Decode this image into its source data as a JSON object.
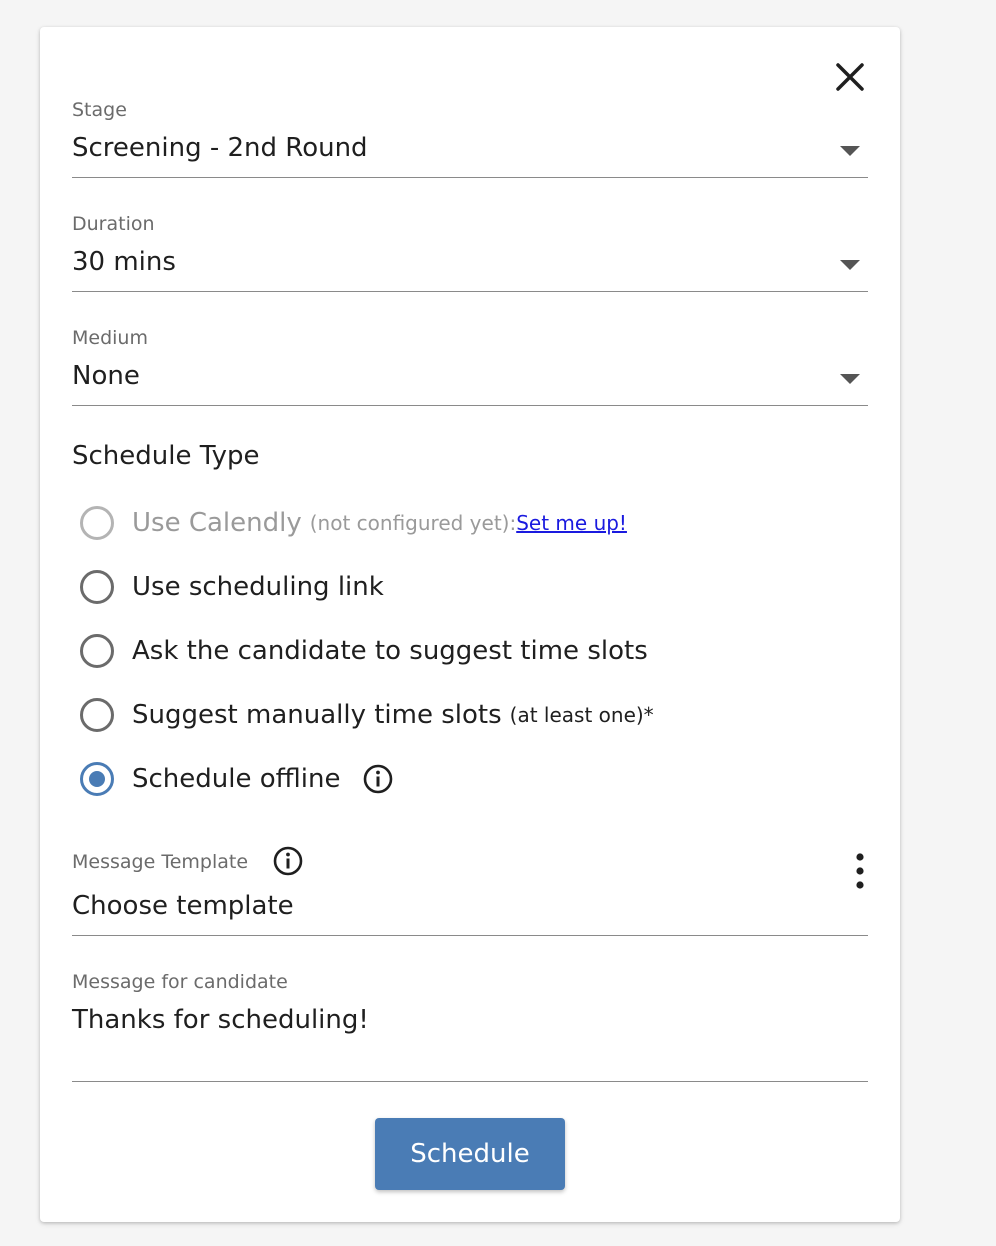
{
  "stage": {
    "label": "Stage",
    "value": "Screening - 2nd Round"
  },
  "duration": {
    "label": "Duration",
    "value": "30 mins"
  },
  "medium": {
    "label": "Medium",
    "value": "None"
  },
  "schedule_type": {
    "title": "Schedule Type",
    "options": [
      {
        "label": "Use Calendly",
        "note": "(not configured yet):",
        "link": "Set me up!",
        "state": "disabled"
      },
      {
        "label": "Use scheduling link",
        "state": "unchecked"
      },
      {
        "label": "Ask the candidate to suggest time slots",
        "state": "unchecked"
      },
      {
        "label": "Suggest manually time slots",
        "note": "(at least one)*",
        "state": "unchecked"
      },
      {
        "label": "Schedule offline",
        "state": "checked"
      }
    ]
  },
  "message_template": {
    "label": "Message Template",
    "value": "Choose template"
  },
  "message_for_candidate": {
    "label": "Message for candidate",
    "value": "Thanks for scheduling!"
  },
  "actions": {
    "schedule_label": "Schedule"
  },
  "colors": {
    "accent": "#4a7cb5",
    "link": "#1a1adf"
  },
  "icons": {
    "close": "close-icon",
    "dropdown": "caret-down-icon",
    "info": "info-icon",
    "more": "more-vert-icon"
  }
}
